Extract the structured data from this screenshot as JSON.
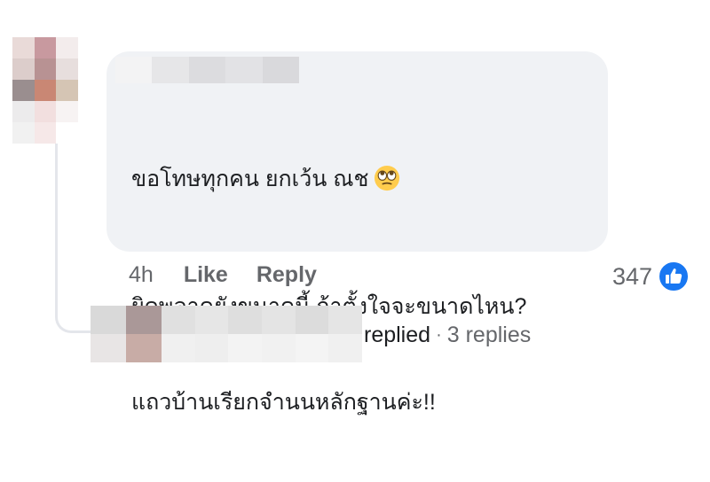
{
  "comment": {
    "text_line1": "ขอโทษทุกคน ยกเว้น ณช",
    "emoji": "eye-roll-emoji",
    "text_line2": "ผิดพลาดยังขนาดนี้ ถ้าตั้งใจจะขนาดไหน?",
    "text_line3": "แถวบ้านเรียกจำนนหลักฐานค่ะ!!"
  },
  "actions": {
    "time": "4h",
    "like_label": "Like",
    "reply_label": "Reply"
  },
  "reactions": {
    "count": "347",
    "icon": "like-thumb-icon",
    "color": "#1877f2"
  },
  "replies": {
    "verb": "replied",
    "separator": "·",
    "count_label": "3 replies"
  }
}
